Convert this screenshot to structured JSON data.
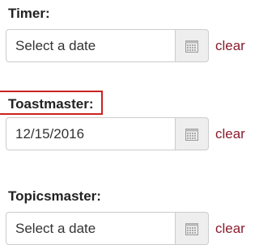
{
  "fields": [
    {
      "label": "Timer:",
      "value": "",
      "placeholder": "Select a date",
      "clear_label": "clear"
    },
    {
      "label": "Toastmaster:",
      "value": "12/15/2016",
      "placeholder": "Select a date",
      "clear_label": "clear",
      "highlighted": true
    },
    {
      "label": "Topicsmaster:",
      "value": "",
      "placeholder": "Select a date",
      "clear_label": "clear"
    }
  ],
  "colors": {
    "label_text": "#222222",
    "input_text": "#333333",
    "clear_link": "#8a1d2e",
    "highlight_border": "#cc2222",
    "addon_background": "#eeeeee",
    "border": "#cccccc"
  },
  "icons": {
    "calendar": "calendar-icon"
  }
}
